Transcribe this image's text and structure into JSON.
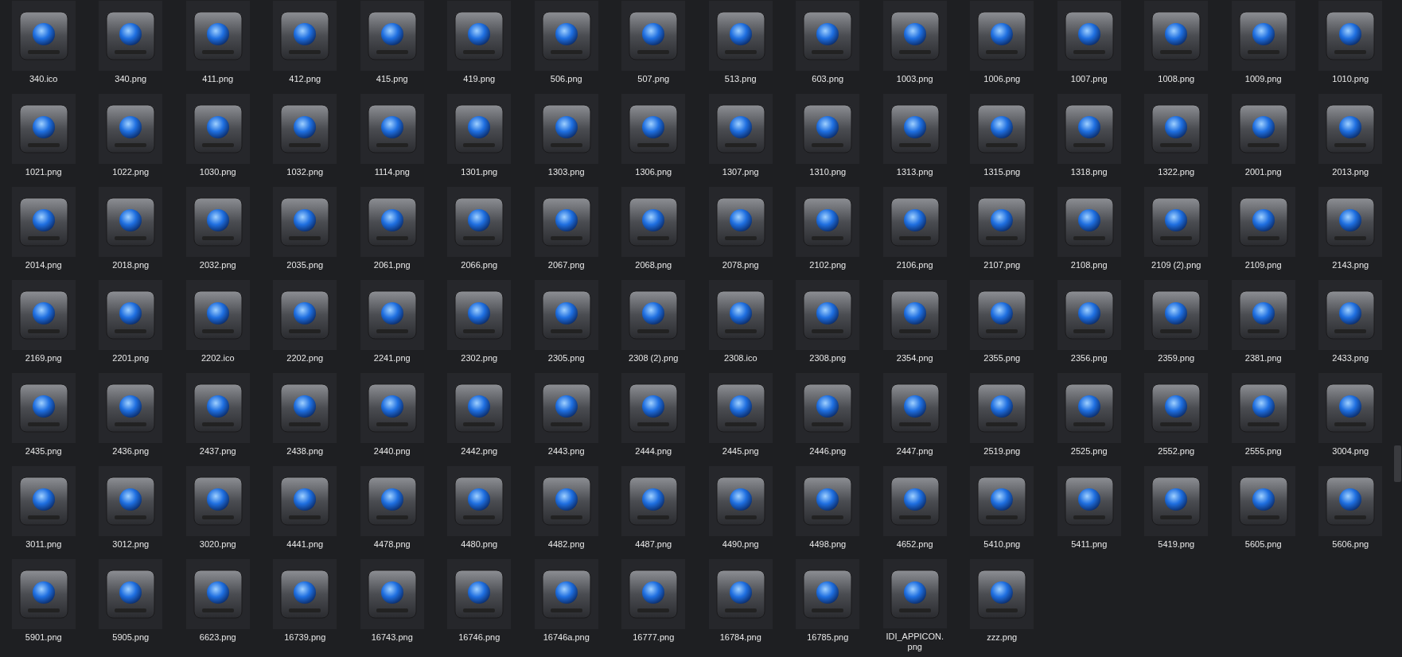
{
  "files": [
    "340.ico",
    "340.png",
    "411.png",
    "412.png",
    "415.png",
    "419.png",
    "506.png",
    "507.png",
    "513.png",
    "603.png",
    "1003.png",
    "1006.png",
    "1007.png",
    "1008.png",
    "1009.png",
    "1010.png",
    "1021.png",
    "1022.png",
    "1030.png",
    "1032.png",
    "1114.png",
    "1301.png",
    "1303.png",
    "1306.png",
    "1307.png",
    "1310.png",
    "1313.png",
    "1315.png",
    "1318.png",
    "1322.png",
    "2001.png",
    "2013.png",
    "2014.png",
    "2018.png",
    "2032.png",
    "2035.png",
    "2061.png",
    "2066.png",
    "2067.png",
    "2068.png",
    "2078.png",
    "2102.png",
    "2106.png",
    "2107.png",
    "2108.png",
    "2109 (2).png",
    "2109.png",
    "2143.png",
    "2169.png",
    "2201.png",
    "2202.ico",
    "2202.png",
    "2241.png",
    "2302.png",
    "2305.png",
    "2308 (2).png",
    "2308.ico",
    "2308.png",
    "2354.png",
    "2355.png",
    "2356.png",
    "2359.png",
    "2381.png",
    "2433.png",
    "2435.png",
    "2436.png",
    "2437.png",
    "2438.png",
    "2440.png",
    "2442.png",
    "2443.png",
    "2444.png",
    "2445.png",
    "2446.png",
    "2447.png",
    "2519.png",
    "2525.png",
    "2552.png",
    "2555.png",
    "3004.png",
    "3011.png",
    "3012.png",
    "3020.png",
    "4441.png",
    "4478.png",
    "4480.png",
    "4482.png",
    "4487.png",
    "4490.png",
    "4498.png",
    "4652.png",
    "5410.png",
    "5411.png",
    "5419.png",
    "5605.png",
    "5606.png",
    "5901.png",
    "5905.png",
    "6623.png",
    "16739.png",
    "16743.png",
    "16746.png",
    "16746a.png",
    "16777.png",
    "16784.png",
    "16785.png",
    "IDI_APPICON.png",
    "zzz.png"
  ]
}
